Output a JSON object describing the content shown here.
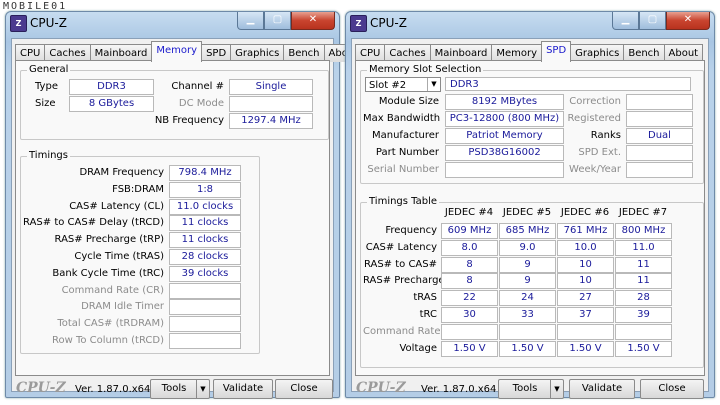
{
  "watermark": "MOBILE01",
  "left": {
    "title": "CPU-Z",
    "tabs": [
      "CPU",
      "Caches",
      "Mainboard",
      "Memory",
      "SPD",
      "Graphics",
      "Bench",
      "About"
    ],
    "general_title": "General",
    "type_label": "Type",
    "type_value": "DDR3",
    "size_label": "Size",
    "size_value": "8 GBytes",
    "channel_label": "Channel #",
    "channel_value": "Single",
    "dcmode_label": "DC Mode",
    "dcmode_value": "",
    "nbfreq_label": "NB Frequency",
    "nbfreq_value": "1297.4 MHz",
    "timings_title": "Timings",
    "timings": [
      {
        "label": "DRAM Frequency",
        "value": "798.4 MHz",
        "dim": false
      },
      {
        "label": "FSB:DRAM",
        "value": "1:8",
        "dim": false
      },
      {
        "label": "CAS# Latency (CL)",
        "value": "11.0 clocks",
        "dim": false
      },
      {
        "label": "RAS# to CAS# Delay (tRCD)",
        "value": "11 clocks",
        "dim": false
      },
      {
        "label": "RAS# Precharge (tRP)",
        "value": "11 clocks",
        "dim": false
      },
      {
        "label": "Cycle Time (tRAS)",
        "value": "28 clocks",
        "dim": false
      },
      {
        "label": "Bank Cycle Time (tRC)",
        "value": "39 clocks",
        "dim": false
      },
      {
        "label": "Command Rate (CR)",
        "value": "",
        "dim": true
      },
      {
        "label": "DRAM Idle Timer",
        "value": "",
        "dim": true
      },
      {
        "label": "Total CAS# (tRDRAM)",
        "value": "",
        "dim": true
      },
      {
        "label": "Row To Column (tRCD)",
        "value": "",
        "dim": true
      }
    ],
    "brand": "CPU-Z",
    "version": "Ver. 1.87.0.x64",
    "tools": "Tools",
    "validate": "Validate",
    "close": "Close"
  },
  "right": {
    "title": "CPU-Z",
    "tabs": [
      "CPU",
      "Caches",
      "Mainboard",
      "Memory",
      "SPD",
      "Graphics",
      "Bench",
      "About"
    ],
    "slot_title": "Memory Slot Selection",
    "slot_value": "Slot #2",
    "slot_type": "DDR3",
    "module_size_label": "Module Size",
    "module_size_value": "8192 MBytes",
    "max_bw_label": "Max Bandwidth",
    "max_bw_value": "PC3-12800 (800 MHz)",
    "manufacturer_label": "Manufacturer",
    "manufacturer_value": "Patriot Memory",
    "part_label": "Part Number",
    "part_value": "PSD38G16002",
    "serial_label": "Serial Number",
    "serial_value": "",
    "correction_label": "Correction",
    "registered_label": "Registered",
    "ranks_label": "Ranks",
    "ranks_value": "Dual",
    "spdext_label": "SPD Ext.",
    "weekyear_label": "Week/Year",
    "timings_title": "Timings Table",
    "jedec_headers": [
      "JEDEC #4",
      "JEDEC #5",
      "JEDEC #6",
      "JEDEC #7"
    ],
    "rows": [
      {
        "label": "Frequency",
        "values": [
          "609 MHz",
          "685 MHz",
          "761 MHz",
          "800 MHz"
        ],
        "dim": false
      },
      {
        "label": "CAS# Latency",
        "values": [
          "8.0",
          "9.0",
          "10.0",
          "11.0"
        ],
        "dim": false
      },
      {
        "label": "RAS# to CAS#",
        "values": [
          "8",
          "9",
          "10",
          "11"
        ],
        "dim": false
      },
      {
        "label": "RAS# Precharge",
        "values": [
          "8",
          "9",
          "10",
          "11"
        ],
        "dim": false
      },
      {
        "label": "tRAS",
        "values": [
          "22",
          "24",
          "27",
          "28"
        ],
        "dim": false
      },
      {
        "label": "tRC",
        "values": [
          "30",
          "33",
          "37",
          "39"
        ],
        "dim": false
      },
      {
        "label": "Command Rate",
        "values": [
          "",
          "",
          "",
          ""
        ],
        "dim": true
      },
      {
        "label": "Voltage",
        "values": [
          "1.50 V",
          "1.50 V",
          "1.50 V",
          "1.50 V"
        ],
        "dim": false
      }
    ],
    "brand": "CPU-Z",
    "version": "Ver. 1.87.0.x64",
    "tools": "Tools",
    "validate": "Validate",
    "close": "Close"
  }
}
